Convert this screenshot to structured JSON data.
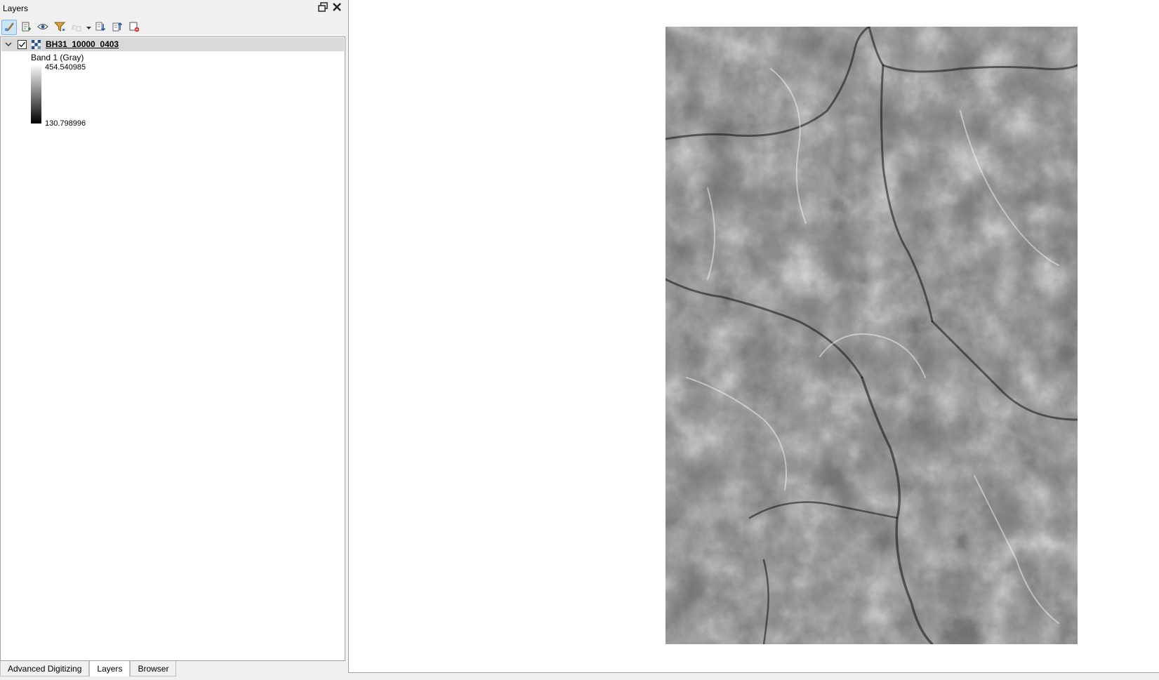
{
  "dock": {
    "title": "Layers"
  },
  "toolbar": {
    "buttons": [
      {
        "id": "style-manager",
        "icon": "paintbrush-icon"
      },
      {
        "id": "add-group",
        "icon": "add-group-icon"
      },
      {
        "id": "manage-visibility",
        "icon": "eye-icon"
      },
      {
        "id": "filter-legend",
        "icon": "filter-icon"
      },
      {
        "id": "filter-expression",
        "icon": "filter-expression-icon"
      },
      {
        "id": "expand-all",
        "icon": "expand-all-icon"
      },
      {
        "id": "collapse-all",
        "icon": "collapse-all-icon"
      },
      {
        "id": "remove-layer",
        "icon": "remove-layer-icon"
      }
    ]
  },
  "layer": {
    "name": "BH31_10000_0403",
    "visible": true,
    "band_label": "Band 1 (Gray)",
    "max_value": "454.540985",
    "min_value": "130.798996"
  },
  "tabs": [
    {
      "label": "Advanced Digitizing",
      "selected": false
    },
    {
      "label": "Layers",
      "selected": true
    },
    {
      "label": "Browser",
      "selected": false
    }
  ],
  "colors": {
    "selected_row": "#d9d9d9",
    "active_button": "#cde4f7"
  }
}
